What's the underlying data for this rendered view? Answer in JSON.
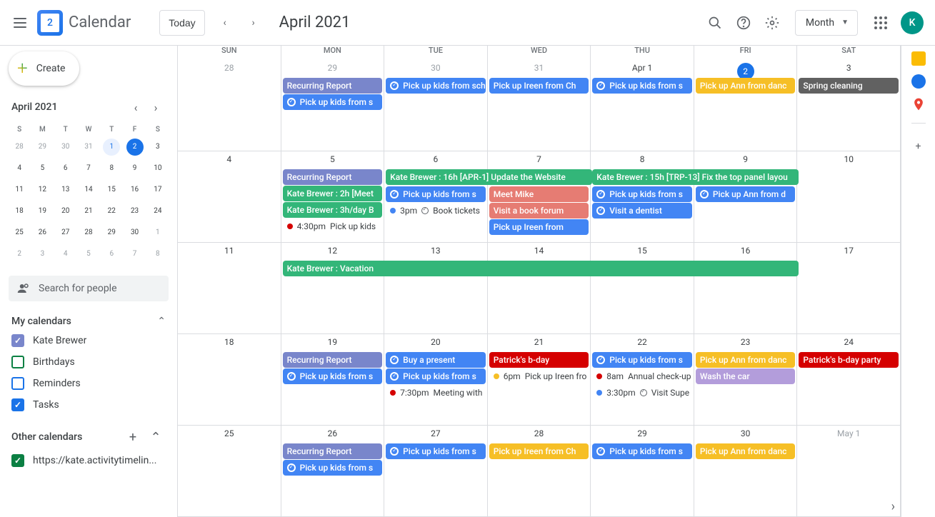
{
  "header": {
    "logo_day": "2",
    "app_name": "Calendar",
    "today_label": "Today",
    "period": "April 2021",
    "view_label": "Month",
    "avatar_initial": "K"
  },
  "sidebar": {
    "create_label": "Create",
    "mini_title": "April 2021",
    "dow": [
      "S",
      "M",
      "T",
      "W",
      "T",
      "F",
      "S"
    ],
    "mini_days": [
      {
        "n": "28",
        "dim": true
      },
      {
        "n": "29",
        "dim": true
      },
      {
        "n": "30",
        "dim": true
      },
      {
        "n": "31",
        "dim": true
      },
      {
        "n": "1",
        "today": true
      },
      {
        "n": "2",
        "selected": true
      },
      {
        "n": "3"
      },
      {
        "n": "4"
      },
      {
        "n": "5"
      },
      {
        "n": "6"
      },
      {
        "n": "7"
      },
      {
        "n": "8"
      },
      {
        "n": "9"
      },
      {
        "n": "10"
      },
      {
        "n": "11"
      },
      {
        "n": "12"
      },
      {
        "n": "13"
      },
      {
        "n": "14"
      },
      {
        "n": "15"
      },
      {
        "n": "16"
      },
      {
        "n": "17"
      },
      {
        "n": "18"
      },
      {
        "n": "19"
      },
      {
        "n": "20"
      },
      {
        "n": "21"
      },
      {
        "n": "22"
      },
      {
        "n": "23"
      },
      {
        "n": "24"
      },
      {
        "n": "25"
      },
      {
        "n": "26"
      },
      {
        "n": "27"
      },
      {
        "n": "28"
      },
      {
        "n": "29"
      },
      {
        "n": "30"
      },
      {
        "n": "1",
        "dim": true
      },
      {
        "n": "2",
        "dim": true
      },
      {
        "n": "3",
        "dim": true
      },
      {
        "n": "4",
        "dim": true
      },
      {
        "n": "5",
        "dim": true
      },
      {
        "n": "6",
        "dim": true
      },
      {
        "n": "7",
        "dim": true
      },
      {
        "n": "8",
        "dim": true
      }
    ],
    "search_placeholder": "Search for people",
    "my_calendars_label": "My calendars",
    "my_calendars": [
      {
        "label": "Kate Brewer",
        "color": "#7986cb",
        "checked": true
      },
      {
        "label": "Birthdays",
        "color": "#0b8043",
        "checked": false
      },
      {
        "label": "Reminders",
        "color": "#1a73e8",
        "checked": false
      },
      {
        "label": "Tasks",
        "color": "#1a73e8",
        "checked": true
      }
    ],
    "other_calendars_label": "Other calendars",
    "other_calendars": [
      {
        "label": "https://kate.activitytimelin...",
        "color": "#0b8043",
        "checked": true
      }
    ]
  },
  "grid": {
    "dow": [
      "SUN",
      "MON",
      "TUE",
      "WED",
      "THU",
      "FRI",
      "SAT"
    ],
    "weeks": [
      {
        "days": [
          {
            "num": "28",
            "dim": true,
            "events": []
          },
          {
            "num": "29",
            "dim": true,
            "events": [
              {
                "type": "block",
                "color": "#7986cb",
                "text": "Recurring Report"
              },
              {
                "type": "task",
                "color": "#4285f4",
                "text": "Pick up kids from s"
              }
            ]
          },
          {
            "num": "30",
            "dim": true,
            "events": [
              {
                "type": "task",
                "color": "#4285f4",
                "text": "Pick up kids from scho"
              }
            ]
          },
          {
            "num": "31",
            "dim": true,
            "events": [
              {
                "type": "block",
                "color": "#4285f4",
                "text": "Pick up Ireen from Ch"
              }
            ]
          },
          {
            "num": "Apr 1",
            "events": [
              {
                "type": "task",
                "color": "#4285f4",
                "text": "Pick up kids from s"
              }
            ]
          },
          {
            "num": "2",
            "selected": true,
            "events": [
              {
                "type": "block",
                "color": "#f6bf26",
                "text": "Pick up Ann from danc"
              }
            ]
          },
          {
            "num": "3",
            "events": [
              {
                "type": "block",
                "color": "#616161",
                "text": "Spring cleaning"
              }
            ]
          }
        ]
      },
      {
        "days": [
          {
            "num": "4",
            "events": []
          },
          {
            "num": "5",
            "events": [
              {
                "type": "block",
                "color": "#7986cb",
                "text": "Recurring Report"
              },
              {
                "type": "block",
                "color": "#33b679",
                "text": "Kate Brewer : 2h [Meet"
              },
              {
                "type": "block",
                "color": "#33b679",
                "text": "Kate Brewer : 3h/day B"
              },
              {
                "type": "timed",
                "dot": "#d50000",
                "time": "4:30pm",
                "text": "Pick up kids"
              }
            ]
          },
          {
            "num": "6",
            "events": [
              {
                "type": "skip"
              },
              {
                "type": "task",
                "color": "#4285f4",
                "text": "Pick up kids from s"
              },
              {
                "type": "timed",
                "dot": "#4285f4",
                "time": "3pm",
                "ring": true,
                "text": "Book tickets"
              }
            ]
          },
          {
            "num": "7",
            "events": [
              {
                "type": "skip"
              },
              {
                "type": "block",
                "color": "#e67c73",
                "text": "Meet Mike"
              },
              {
                "type": "block",
                "color": "#e67c73",
                "text": "Visit a book forum"
              },
              {
                "type": "block",
                "color": "#4285f4",
                "text": "Pick up Ireen from"
              }
            ]
          },
          {
            "num": "8",
            "events": [
              {
                "type": "skip"
              },
              {
                "type": "task",
                "color": "#4285f4",
                "text": "Pick up kids from s"
              },
              {
                "type": "task",
                "color": "#4285f4",
                "text": "Visit a dentist"
              }
            ]
          },
          {
            "num": "9",
            "events": [
              {
                "type": "skip"
              },
              {
                "type": "task",
                "color": "#4285f4",
                "text": "Pick up Ann from d"
              }
            ]
          },
          {
            "num": "10",
            "events": []
          }
        ],
        "spans": [
          {
            "row": 0,
            "colStart": 2,
            "colEnd": 4,
            "color": "#33b679",
            "text": "Kate Brewer : 16h [APR-1] Update the Website"
          },
          {
            "row": 0,
            "colStart": 4,
            "colEnd": 6,
            "color": "#33b679",
            "text": "Kate Brewer : 15h [TRP-13] Fix the top panel layou"
          }
        ]
      },
      {
        "days": [
          {
            "num": "11",
            "events": []
          },
          {
            "num": "12",
            "events": []
          },
          {
            "num": "13",
            "events": []
          },
          {
            "num": "14",
            "events": []
          },
          {
            "num": "15",
            "events": []
          },
          {
            "num": "16",
            "events": []
          },
          {
            "num": "17",
            "events": []
          }
        ],
        "spans": [
          {
            "row": 0,
            "colStart": 1,
            "colEnd": 6,
            "color": "#33b679",
            "text": "Kate Brewer : Vacation"
          }
        ]
      },
      {
        "days": [
          {
            "num": "18",
            "events": []
          },
          {
            "num": "19",
            "events": [
              {
                "type": "block",
                "color": "#7986cb",
                "text": "Recurring Report"
              },
              {
                "type": "task",
                "color": "#4285f4",
                "text": "Pick up kids from s"
              }
            ]
          },
          {
            "num": "20",
            "events": [
              {
                "type": "task",
                "color": "#4285f4",
                "text": "Buy a present"
              },
              {
                "type": "task",
                "color": "#4285f4",
                "text": "Pick up kids from s"
              },
              {
                "type": "timed",
                "dot": "#d50000",
                "time": "7:30pm",
                "text": "Meeting with"
              }
            ]
          },
          {
            "num": "21",
            "events": [
              {
                "type": "block",
                "color": "#d50000",
                "text": "Patrick's b-day"
              },
              {
                "type": "timed",
                "dot": "#f6bf26",
                "time": "6pm",
                "text": "Pick up Ireen fro"
              }
            ]
          },
          {
            "num": "22",
            "events": [
              {
                "type": "task",
                "color": "#4285f4",
                "text": "Pick up kids from s"
              },
              {
                "type": "timed",
                "dot": "#d50000",
                "time": "8am",
                "text": "Annual check-up"
              },
              {
                "type": "timed",
                "dot": "#4285f4",
                "time": "3:30pm",
                "ring": true,
                "text": "Visit Supe"
              }
            ]
          },
          {
            "num": "23",
            "events": [
              {
                "type": "block",
                "color": "#f6bf26",
                "text": "Pick up Ann from danc"
              },
              {
                "type": "block",
                "color": "#b39ddb",
                "text": "Wash the car"
              }
            ]
          },
          {
            "num": "24",
            "events": [
              {
                "type": "block",
                "color": "#d50000",
                "text": "Patrick's b-day party"
              }
            ]
          }
        ]
      },
      {
        "days": [
          {
            "num": "25",
            "events": []
          },
          {
            "num": "26",
            "events": [
              {
                "type": "block",
                "color": "#7986cb",
                "text": "Recurring Report"
              },
              {
                "type": "task",
                "color": "#4285f4",
                "text": "Pick up kids from s"
              }
            ]
          },
          {
            "num": "27",
            "events": [
              {
                "type": "task",
                "color": "#4285f4",
                "text": "Pick up kids from s"
              }
            ]
          },
          {
            "num": "28",
            "events": [
              {
                "type": "block",
                "color": "#f6bf26",
                "text": "Pick up Ireen from Ch"
              }
            ]
          },
          {
            "num": "29",
            "events": [
              {
                "type": "task",
                "color": "#4285f4",
                "text": "Pick up kids from s"
              }
            ]
          },
          {
            "num": "30",
            "events": [
              {
                "type": "block",
                "color": "#f6bf26",
                "text": "Pick up Ann from danc"
              }
            ]
          },
          {
            "num": "May 1",
            "dim": true,
            "events": []
          }
        ]
      }
    ]
  }
}
